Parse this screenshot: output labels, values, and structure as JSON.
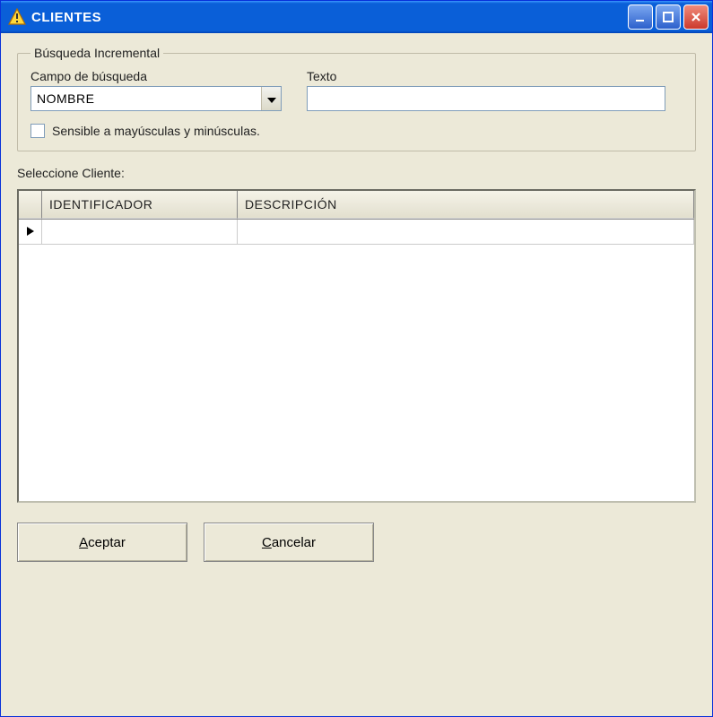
{
  "window": {
    "title": "CLIENTES"
  },
  "search_group": {
    "legend": "Búsqueda Incremental",
    "field_label": "Campo de búsqueda",
    "field_value": "NOMBRE",
    "text_label": "Texto",
    "text_value": "",
    "case_checkbox_label": "Sensible a mayúsculas y minúsculas.",
    "case_checked": false
  },
  "list": {
    "section_label": "Seleccione Cliente:",
    "columns": [
      "IDENTIFICADOR",
      "DESCRIPCIÓN"
    ],
    "rows": [
      {
        "id": "",
        "desc": ""
      }
    ]
  },
  "buttons": {
    "accept": "Aceptar",
    "cancel": "Cancelar"
  }
}
